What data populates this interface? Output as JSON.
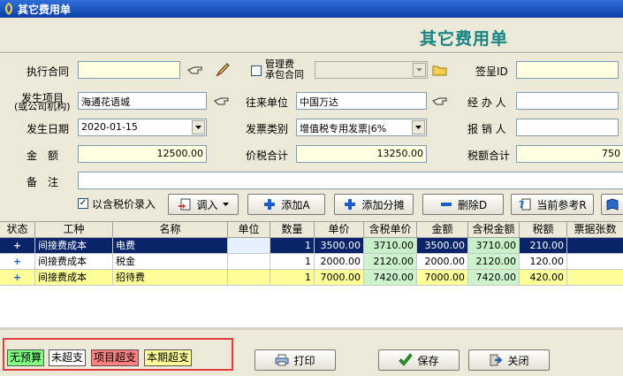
{
  "window": {
    "title": "其它费用单"
  },
  "form_title": "其它费用单",
  "row1": {
    "contract_label": "执行合同",
    "contract_value": "",
    "mgmt_fee_label_1": "管理费",
    "mgmt_fee_label_2": "承包合同",
    "mgmt_fee_checked": false,
    "mgmt_contract_value": "",
    "sign_id_label": "签呈ID",
    "sign_id_value": ""
  },
  "row2": {
    "project_label_1": "发生项目",
    "project_label_2": "(或公司机构)",
    "project_value": "海通花语城",
    "partner_label": "往来单位",
    "partner_value": "中国万达",
    "handler_label": "经 办 人",
    "handler_value": ""
  },
  "row3": {
    "date_label": "发生日期",
    "date_value": "2020-01-15",
    "invoice_type_label": "发票类别",
    "invoice_type_value": "增值税专用发票|6%",
    "reimburser_label": "报 销 人",
    "reimburser_value": ""
  },
  "row4": {
    "amount_label": "金　额",
    "amount_value": "12500.00",
    "total_with_tax_label": "价税合计",
    "total_with_tax_value": "13250.00",
    "tax_total_label": "税额合计",
    "tax_total_value": "750"
  },
  "row5": {
    "remark_label": "备　注",
    "remark_value": ""
  },
  "toolbar": {
    "tax_inclusive_label": "以含税价录入",
    "tax_inclusive_checked": true,
    "import_label": "调入",
    "add_label": "添加A",
    "add_split_label": "添加分摊",
    "delete_label": "删除D",
    "ref_label": "当前参考R"
  },
  "table": {
    "columns": [
      "状态",
      "工种",
      "名称",
      "单位",
      "数量",
      "单价",
      "含税单价",
      "金额",
      "含税金额",
      "税额",
      "票据张数"
    ],
    "rows": [
      {
        "type": "间接费成本",
        "name": "电费",
        "unit": "",
        "qty": "1",
        "price": "3500.00",
        "price_tax": "3710.00",
        "amount": "3500.00",
        "amount_tax": "3710.00",
        "tax": "210.00",
        "receipts": ""
      },
      {
        "type": "间接费成本",
        "name": "税金",
        "unit": "",
        "qty": "1",
        "price": "2000.00",
        "price_tax": "2120.00",
        "amount": "2000.00",
        "amount_tax": "2120.00",
        "tax": "120.00",
        "receipts": ""
      },
      {
        "type": "间接费成本",
        "name": "招待费",
        "unit": "",
        "qty": "1",
        "price": "7000.00",
        "price_tax": "7420.00",
        "amount": "7000.00",
        "amount_tax": "7420.00",
        "tax": "420.00",
        "receipts": ""
      }
    ]
  },
  "legend": {
    "no_budget": "无预算",
    "not_over": "未超支",
    "project_over": "项目超支",
    "period_over": "本期超支",
    "colors": {
      "no_budget": "#80ff80",
      "not_over": "#ffffff",
      "project_over": "#ff8080",
      "period_over": "#ffff99"
    }
  },
  "buttons": {
    "print": "打印",
    "save": "保存",
    "close": "关闭"
  }
}
